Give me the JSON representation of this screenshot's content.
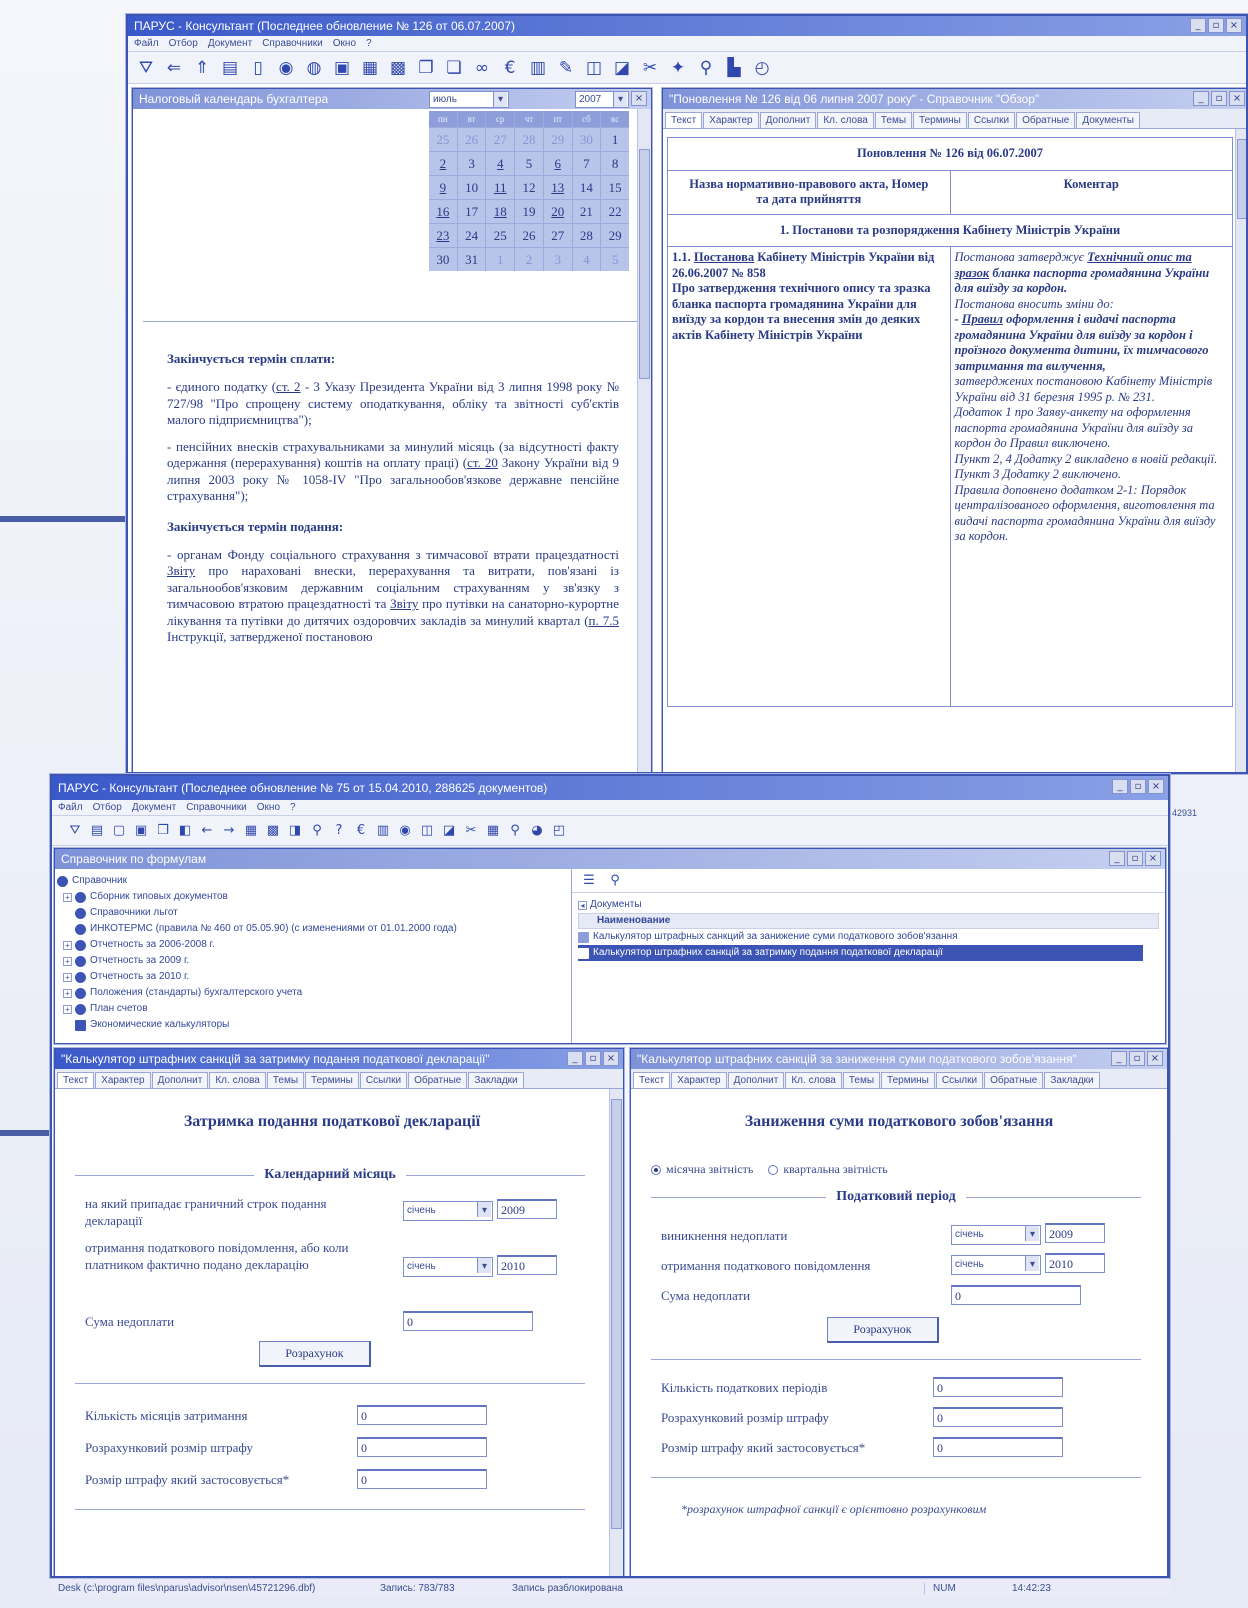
{
  "colors": {
    "accent": "#3c55b5",
    "titlebar": "#3a59c9",
    "text": "#2a3a86"
  },
  "main_window": {
    "title": "ПАРУС - Консультант (Последнее обновление № 126 от 06.07.2007)",
    "menu": [
      "Файл",
      "Отбор",
      "Документ",
      "Справочники",
      "Окно",
      "?"
    ]
  },
  "calendar_window": {
    "title": "Налоговый календарь бухгалтера",
    "month": "июль",
    "year": "2007",
    "weekdays": [
      "пн",
      "вт",
      "ср",
      "чт",
      "пт",
      "сб",
      "вс"
    ],
    "days": [
      "25",
      "26",
      "27",
      "28",
      "29",
      "30",
      "1",
      "2",
      "3",
      "4",
      "5",
      "6",
      "7",
      "8",
      "9",
      "10",
      "11",
      "12",
      "13",
      "14",
      "15",
      "16",
      "17",
      "18",
      "19",
      "20",
      "21",
      "22",
      "23",
      "24",
      "25",
      "26",
      "27",
      "28",
      "29",
      "30",
      "31",
      "1",
      "2",
      "3",
      "4",
      "5"
    ],
    "h1": "Закінчується термін сплати:",
    "p1a": "- єдиного податку (",
    "p1link": "ст. 2",
    "p1b": " - 3 Указу Президента України від 3 липня 1998 року № 727/98 \"Про спрощену систему оподаткування, обліку та звітності суб'єктів малого підприємництва\");",
    "p2a": "- пенсійних внесків страхувальниками за минулий місяць (за відсутності факту одержання (перерахування) коштів на оплату праці) (",
    "p2link": "ст. 20",
    "p2b": " Закону України від 9 липня 2003 року № 1058-IV \"Про загальнообов'язкове державне пенсійне страхування\");",
    "h2": "Закінчується термін подання:",
    "p3a": "- органам Фонду соціального страхування з тимчасової втрати працездатності ",
    "p3link1": "Звіту",
    "p3b": " про нараховані внески, перерахування та витрати, пов'язані із загальнообов'язковим державним соціальним страхуванням у зв'язку з тимчасовою втратою працездатності та ",
    "p3link2": "Звіту",
    "p3c": " про путівки на санаторно-курортне лікування та путівки до дитячих оздоровчих закладів за минулий квартал (",
    "p3link3": "п. 7.5",
    "p3d": " Інструкції, затвердженої постановою"
  },
  "update_window": {
    "title": "\"Поновлення № 126 від 06 липня 2007 року\" - Справочник \"Обзор\"",
    "tabs": [
      "Текст",
      "Характер",
      "Дополнит",
      "Кл. слова",
      "Темы",
      "Термины",
      "Ссылки",
      "Обратные",
      "Документы"
    ],
    "heading": "Поновлення № 126 від 06.07.2007",
    "col1": "Назва нормативно-правового акта, Номер та дата прийняття",
    "col2": "Коментар",
    "section": "1. Постанови та розпорядження Кабінету Міністрів України",
    "row_left_num": "1.1. ",
    "row_left_link": "Постанова",
    "row_left_a": " Кабінету Міністрів України від 26.06.2007 № 858",
    "row_left_b": "Про затвердження технічного опису та зразка бланка паспорта громадянина України для виїзду за кордон та внесення змін до деяких актів Кабінету Міністрів України",
    "c1": "Постанова затверджує ",
    "c1link": "Технічний опис та зразок",
    "c1b": " бланка паспорта громадянина України для виїзду за кордон.",
    "c2": "Постанова вносить зміни до:",
    "c3link": "Правил",
    "c3b": " оформлення і видачі паспорта громадянина України для виїзду за кордон і проїзного документа дитини, їх тимчасового затримання та вилучення,",
    "c4": "затверджених постановою Кабінету Міністрів України від 31 березня 1995 р. № 231.",
    "c5": "Додаток 1 про Заяву-анкету на оформлення паспорта громадянина України для виїзду за кордон до Правил виключено.",
    "c6": "Пункт 2, 4 Додатку 2 викладено в новій редакції.",
    "c7": "Пункт 3 Додатку 2 виключено.",
    "c8": "Правила доповнено додатком 2-1: Порядок централізованого оформлення, виготовлення та видачі паспорта громадянина України для виїзду за кордон."
  },
  "second_app": {
    "title": "ПАРУС - Консультант (Последнее обновление № 75 от 15.04.2010, 288625 документов)",
    "menu": [
      "Файл",
      "Отбор",
      "Документ",
      "Справочники",
      "Окно",
      "?"
    ],
    "side_number": "42931"
  },
  "reference_window": {
    "title": "Справочник по формулам",
    "tree": [
      "Справочник",
      "Сборник типовых документов",
      "Справочники льгот",
      "ИНКОТЕРМС (правила № 460 от 05.05.90) (с изменениями от 01.01.2000 года)",
      "Отчетность за 2006-2008 г.",
      "Отчетность за 2009 г.",
      "Отчетность за 2010 г.",
      "Положения (стандарты) бухгалтерского учета",
      "План счетов",
      "Экономические калькуляторы"
    ],
    "docs_label": "Документы",
    "col_header": "Наименование",
    "rows": [
      "Калькулятор штрафных санкций за занижение суми податкового зобов'язання",
      "Калькулятор штрафних санкцій за затримку подання податкової декларації"
    ]
  },
  "calc1": {
    "title": "\"Калькулятор штрафних санкцій за затримку подання податкової декларації\"",
    "tabs": [
      "Текст",
      "Характер",
      "Дополнит",
      "Кл. слова",
      "Темы",
      "Термины",
      "Ссылки",
      "Обратные",
      "Закладки"
    ],
    "heading": "Затримка подання податкової декларації",
    "section": "Календарний місяць",
    "label1": "на який припадає граничний строк подання декларації",
    "label2": "отримання податкового повідомлення, або коли платником фактично подано декларацію",
    "label3": "Сума недоплати",
    "month1": "січень",
    "year1": "2009",
    "month2": "січень",
    "year2": "2010",
    "amount": "0",
    "button": "Розрахунок",
    "r1": "Кількість місяців затримання",
    "r2": "Розрахунковий розмір штрафу",
    "r3": "Розмір штрафу який застосовується*",
    "v1": "0",
    "v2": "0",
    "v3": "0"
  },
  "calc2": {
    "title": "\"Калькулятор штрафних санкцій за заниження суми податкового зобов'язання\"",
    "tabs": [
      "Текст",
      "Характер",
      "Дополнит",
      "Кл. слова",
      "Темы",
      "Термины",
      "Ссылки",
      "Обратные",
      "Закладки"
    ],
    "heading": "Заниження суми податкового зобов'язання",
    "radio1": "місячна звітність",
    "radio2": "квартальна звітність",
    "section": "Податковий період",
    "label1": "виникнення недоплати",
    "label2": "отримання податкового повідомлення",
    "label3": "Сума недоплати",
    "month1": "січень",
    "year1": "2009",
    "month2": "січень",
    "year2": "2010",
    "amount": "0",
    "button": "Розрахунок",
    "r1": "Кількість податкових періодів",
    "r2": "Розрахунковий розмір штрафу",
    "r3": "Розмір штрафу який застосовується*",
    "v1": "0",
    "v2": "0",
    "v3": "0",
    "footnote": "*розрахунок штрафної санкції є орієнтовно розрахунковим"
  },
  "statusbar": {
    "path": "Desk (c:\\program files\\nparus\\advisor\\nsen\\45721296.dbf)",
    "record": "Запись: 783/783",
    "lock": "Запись разблокирована",
    "num": "NUM",
    "time": "14:42:23"
  }
}
